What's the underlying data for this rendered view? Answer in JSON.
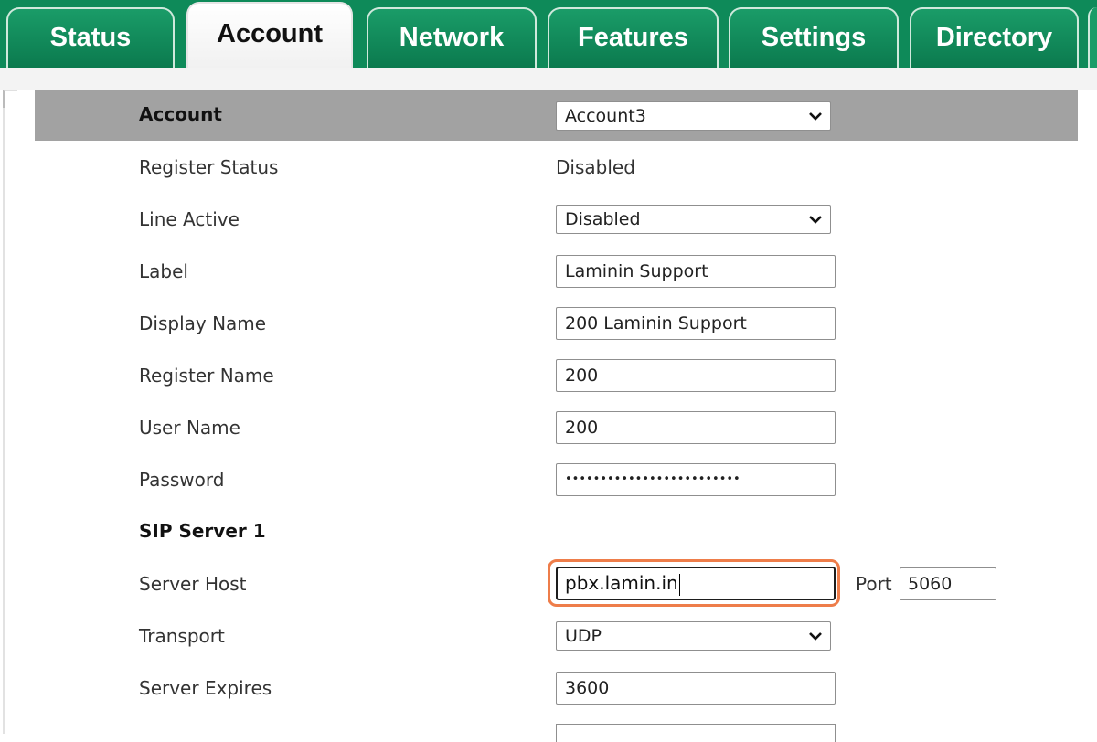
{
  "tabs": [
    {
      "label": "Status",
      "active": false
    },
    {
      "label": "Account",
      "active": true
    },
    {
      "label": "Network",
      "active": false
    },
    {
      "label": "Features",
      "active": false
    },
    {
      "label": "Settings",
      "active": false
    },
    {
      "label": "Directory",
      "active": false
    }
  ],
  "header": {
    "label": "Account",
    "selected": "Account3"
  },
  "fields": {
    "register_status": {
      "label": "Register Status",
      "value": "Disabled"
    },
    "line_active": {
      "label": "Line Active",
      "value": "Disabled"
    },
    "label": {
      "label": "Label",
      "value": "Laminin Support"
    },
    "display_name": {
      "label": "Display Name",
      "value": "200 Laminin Support"
    },
    "register_name": {
      "label": "Register Name",
      "value": "200"
    },
    "user_name": {
      "label": "User Name",
      "value": "200"
    },
    "password": {
      "label": "Password",
      "value": "•••••••••••••••••••••••••"
    }
  },
  "sip_server": {
    "section_title": "SIP Server 1",
    "server_host": {
      "label": "Server Host",
      "value": "pbx.lamin.in"
    },
    "port": {
      "label": "Port",
      "value": "5060"
    },
    "transport": {
      "label": "Transport",
      "value": "UDP"
    },
    "server_expires": {
      "label": "Server Expires",
      "value": "3600"
    }
  },
  "colors": {
    "tab_green": "#0e8a59",
    "header_gray": "#a2a2a2",
    "highlight_orange": "#ee7d4a"
  }
}
